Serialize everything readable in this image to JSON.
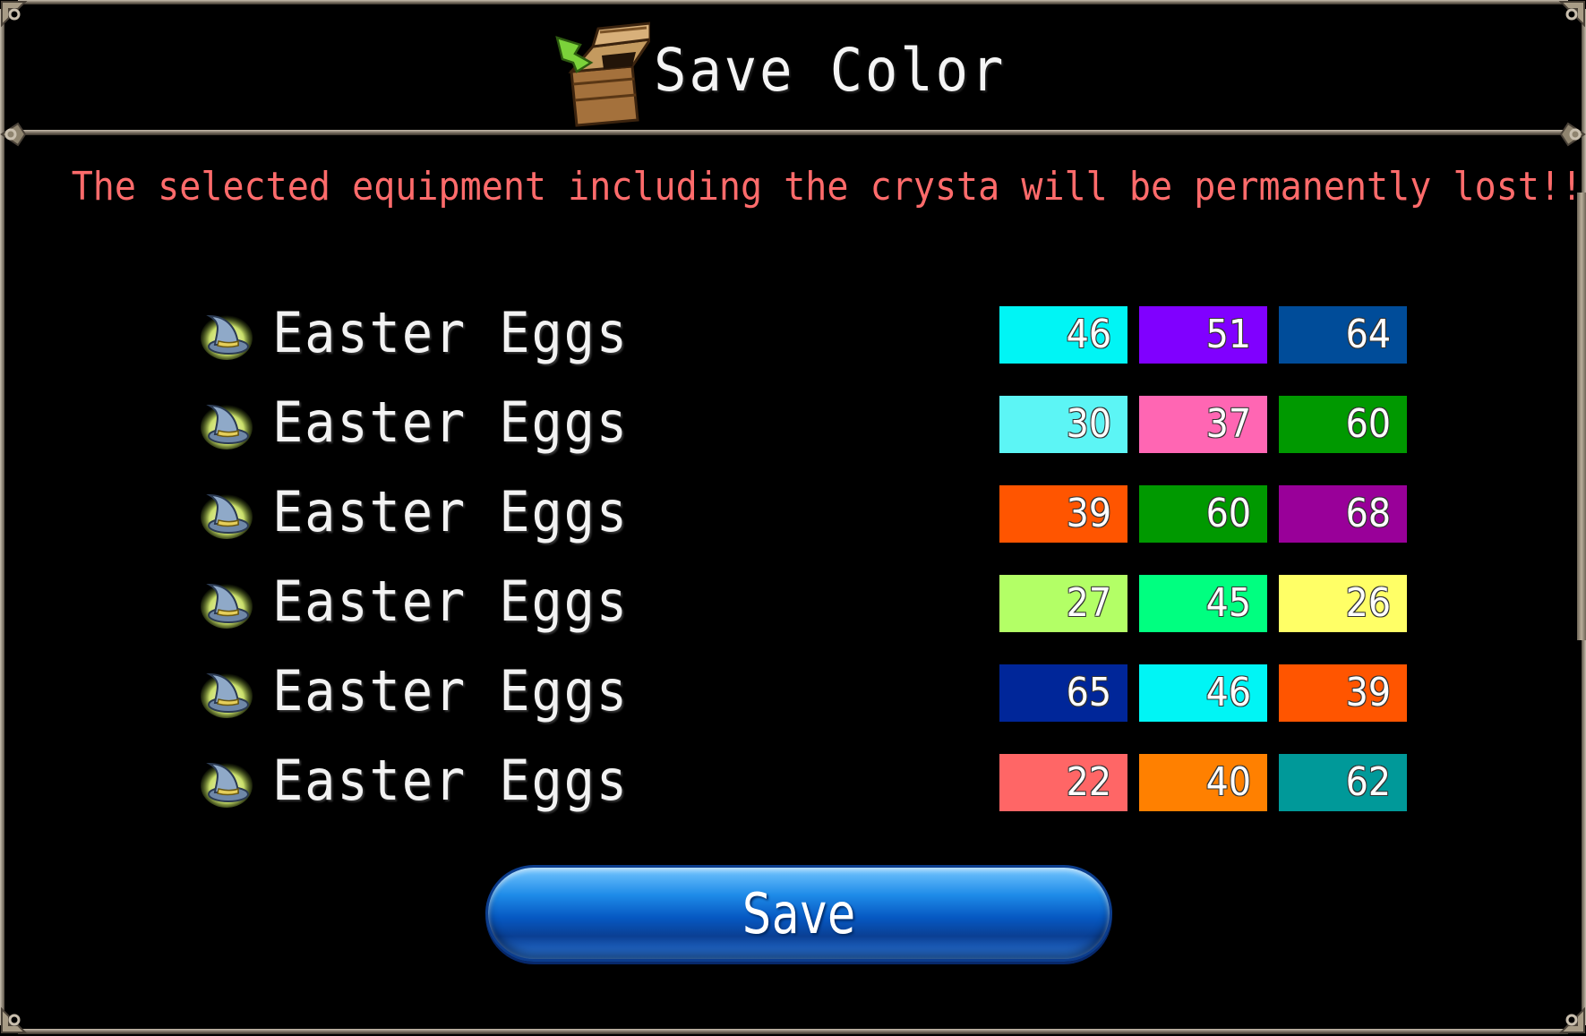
{
  "header": {
    "title": "Save Color",
    "icon": "treasure-chest-icon"
  },
  "warning": {
    "text": "The selected equipment including the crysta will be permanently lost!!",
    "color": "#ff6b6b"
  },
  "items": [
    {
      "name": "Easter Eggs",
      "icon": "wizard-hat-icon",
      "colors": [
        {
          "value": "46",
          "color": "#00f5f5"
        },
        {
          "value": "51",
          "color": "#8000ff"
        },
        {
          "value": "64",
          "color": "#004c99"
        }
      ]
    },
    {
      "name": "Easter Eggs",
      "icon": "wizard-hat-icon",
      "colors": [
        {
          "value": "30",
          "color": "#5cf5f5"
        },
        {
          "value": "37",
          "color": "#ff66b3"
        },
        {
          "value": "60",
          "color": "#009900"
        }
      ]
    },
    {
      "name": "Easter Eggs",
      "icon": "wizard-hat-icon",
      "colors": [
        {
          "value": "39",
          "color": "#ff5500"
        },
        {
          "value": "60",
          "color": "#009900"
        },
        {
          "value": "68",
          "color": "#990099"
        }
      ]
    },
    {
      "name": "Easter Eggs",
      "icon": "wizard-hat-icon",
      "colors": [
        {
          "value": "27",
          "color": "#b3ff66"
        },
        {
          "value": "45",
          "color": "#00ff80"
        },
        {
          "value": "26",
          "color": "#ffff66"
        }
      ]
    },
    {
      "name": "Easter Eggs",
      "icon": "wizard-hat-icon",
      "colors": [
        {
          "value": "65",
          "color": "#002699"
        },
        {
          "value": "46",
          "color": "#00f5f5"
        },
        {
          "value": "39",
          "color": "#ff5500"
        }
      ]
    },
    {
      "name": "Easter Eggs",
      "icon": "wizard-hat-icon",
      "colors": [
        {
          "value": "22",
          "color": "#ff6666"
        },
        {
          "value": "40",
          "color": "#ff8000"
        },
        {
          "value": "62",
          "color": "#009999"
        }
      ]
    }
  ],
  "save_button": {
    "label": "Save"
  }
}
